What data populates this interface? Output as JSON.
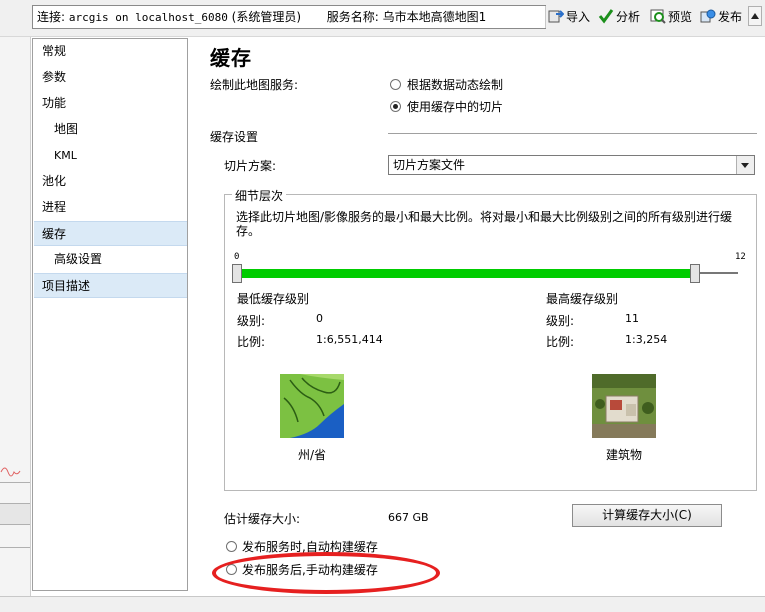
{
  "toolbar": {
    "connection_label": "连接:",
    "connection_value": "arcgis on localhost_6080",
    "connection_role": "(系统管理员)",
    "service_name_label": "服务名称:",
    "service_name_value": "乌市本地高德地图1",
    "import_label": "导入",
    "analyze_label": "分析",
    "preview_label": "预览",
    "publish_label": "发布"
  },
  "nav": {
    "items": [
      {
        "label": "常规"
      },
      {
        "label": "参数"
      },
      {
        "label": "功能"
      },
      {
        "label": "地图"
      },
      {
        "label": "KML"
      },
      {
        "label": "池化"
      },
      {
        "label": "进程"
      },
      {
        "label": "缓存"
      },
      {
        "label": "高级设置"
      },
      {
        "label": "项目描述"
      }
    ]
  },
  "main": {
    "title": "缓存",
    "draw_service_label": "绘制此地图服务:",
    "option_dynamic": "根据数据动态绘制",
    "option_cached": "使用缓存中的切片",
    "cache_settings_label": "缓存设置",
    "tiling_scheme_label": "切片方案:",
    "tiling_scheme_value": "切片方案文件",
    "lod": {
      "legend": "细节层次",
      "description": "选择此切片地图/影像服务的最小和最大比例。将对最小和最大比例级别之间的所有级别进行缓存。",
      "slider_min_label": "0",
      "slider_max_label": "12",
      "slider_min": 0,
      "slider_max": 12,
      "selected_low": 0,
      "selected_high": 11,
      "min_level_title": "最低缓存级别",
      "min_level_label": "级别:",
      "min_level_value": "0",
      "min_scale_label": "比例:",
      "min_scale_value": "1:6,551,414",
      "max_level_title": "最高缓存级别",
      "max_level_label": "级别:",
      "max_level_value": "11",
      "max_scale_label": "比例:",
      "max_scale_value": "1:3,254",
      "min_image_caption": "州/省",
      "max_image_caption": "建筑物"
    },
    "estimate_label": "估计缓存大小:",
    "estimate_value": "667 GB",
    "calc_button": "计算缓存大小(C)",
    "option_auto_build": "发布服务时,自动构建缓存",
    "option_manual_build": "发布服务后,手动构建缓存"
  },
  "colors": {
    "slider_fill": "#00cc00",
    "selected_nav": "#dbeaf7",
    "annotation_ellipse": "#e62020"
  }
}
